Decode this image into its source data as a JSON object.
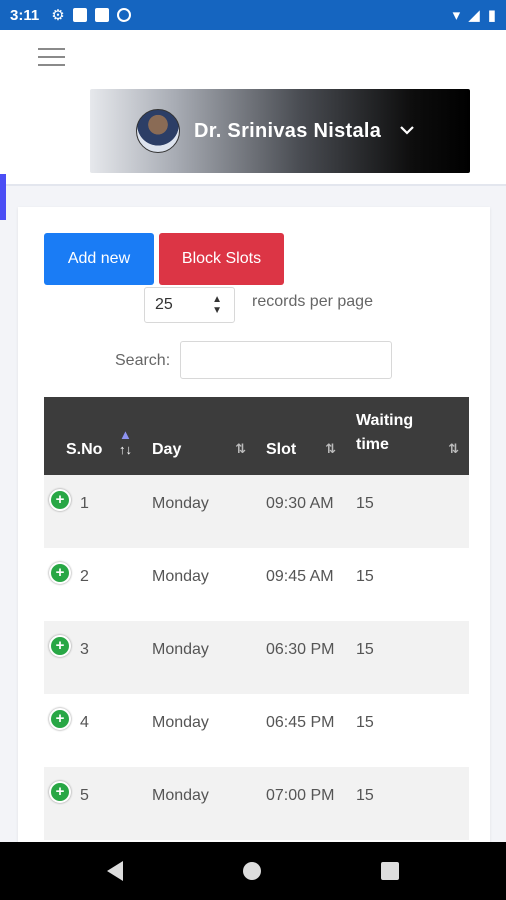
{
  "status_bar": {
    "time": "3:11"
  },
  "header": {
    "doctor_name": "Dr. Srinivas Nistala",
    "chevron": "⌄"
  },
  "toolbar": {
    "add_label": "Add new",
    "block_label": "Block Slots"
  },
  "pagination": {
    "selected": "25",
    "label": "records per page"
  },
  "search": {
    "label": "Search:",
    "value": ""
  },
  "table": {
    "headers": [
      "S.No",
      "Day",
      "Slot",
      "Waiting time"
    ],
    "rows": [
      {
        "sno": "1",
        "day": "Monday",
        "slot": "09:30 AM",
        "waiting": "15"
      },
      {
        "sno": "2",
        "day": "Monday",
        "slot": "09:45 AM",
        "waiting": "15"
      },
      {
        "sno": "3",
        "day": "Monday",
        "slot": "06:30 PM",
        "waiting": "15"
      },
      {
        "sno": "4",
        "day": "Monday",
        "slot": "06:45 PM",
        "waiting": "15"
      },
      {
        "sno": "5",
        "day": "Monday",
        "slot": "07:00 PM",
        "waiting": "15"
      }
    ]
  },
  "colors": {
    "status_bar": "#1565c0",
    "add_button": "#1a7cf5",
    "block_button": "#dc3545",
    "table_header": "#3c3c3c",
    "expand_icon": "#28a745"
  },
  "icons": [
    "settings-icon",
    "notification-icon",
    "sd-card-icon",
    "vpn-icon",
    "wifi-icon",
    "signal-icon",
    "battery-icon",
    "menu-icon",
    "avatar",
    "chevron-down-icon",
    "plus-icon",
    "sort-icon"
  ]
}
